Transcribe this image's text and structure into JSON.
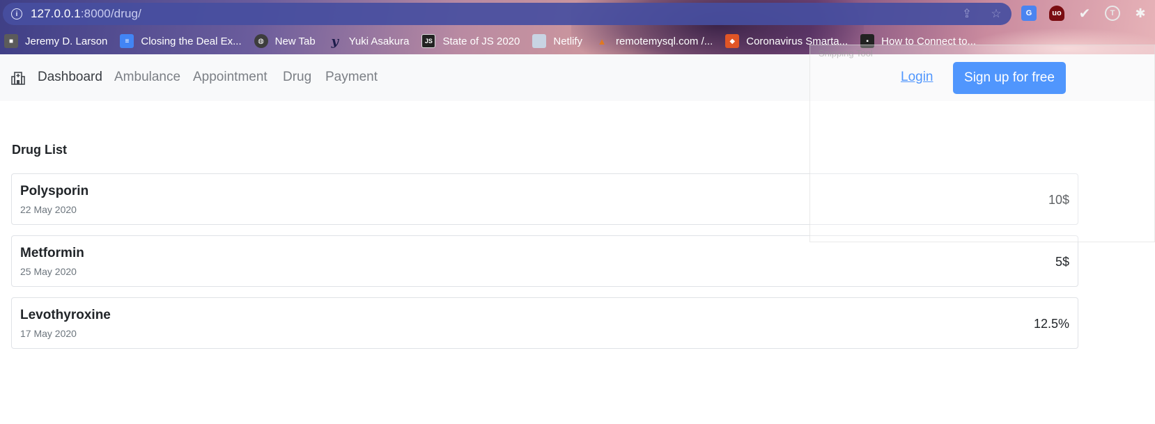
{
  "browser": {
    "url_host": "127.0.0.1",
    "url_rest": ":8000/drug/",
    "bookmarks": [
      {
        "label": "Jeremy D. Larson",
        "icon": "cube-icon"
      },
      {
        "label": "Closing the Deal Ex...",
        "icon": "google-docs-icon"
      },
      {
        "label": "New Tab",
        "icon": "globe-icon"
      },
      {
        "label": "Yuki Asakura",
        "icon": "y-logo-icon"
      },
      {
        "label": "State of JS 2020",
        "icon": "js-icon"
      },
      {
        "label": "Netlify",
        "icon": "netlify-icon"
      },
      {
        "label": "remotemysql.com /...",
        "icon": "phpmyadmin-icon"
      },
      {
        "label": "Coronavirus Smarta...",
        "icon": "coronavirus-icon"
      },
      {
        "label": "How to Connect to...",
        "icon": "floppy-icon"
      }
    ]
  },
  "overlay": {
    "label": "Snipping Tool"
  },
  "navbar": {
    "links": [
      {
        "label": "Dashboard"
      },
      {
        "label": "Ambulance"
      },
      {
        "label": "Appointment"
      },
      {
        "label": "Drug"
      },
      {
        "label": "Payment"
      }
    ],
    "login": "Login",
    "signup": "Sign up for free"
  },
  "drug_list": {
    "title": "Drug List",
    "items": [
      {
        "name": "Polysporin",
        "date": "22 May 2020",
        "price": "10$"
      },
      {
        "name": "Metformin",
        "date": "25 May 2020",
        "price": "5$"
      },
      {
        "name": "Levothyroxine",
        "date": "17 May 2020",
        "price": "12.5%"
      }
    ]
  },
  "colors": {
    "primary": "#0d6efd",
    "navbar_bg": "#f8f9fa",
    "omnibox_bg": "#464ea0"
  }
}
